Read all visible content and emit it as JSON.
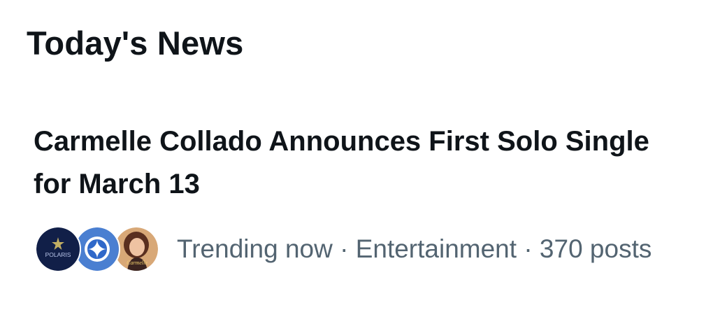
{
  "section": {
    "title": "Today's News"
  },
  "news_item": {
    "headline": "Carmelle Collado Announces First Solo Single for March 13",
    "avatars": [
      {
        "label": "POLARIS",
        "icon": "polaris-logo-avatar"
      },
      {
        "icon": "swirl-logo-avatar"
      },
      {
        "label": "Carmelle",
        "icon": "portrait-avatar"
      }
    ],
    "meta": "Trending now · Entertainment · 370 posts"
  },
  "colors": {
    "text_primary": "#0f1419",
    "text_secondary": "#536471",
    "background": "#ffffff"
  }
}
